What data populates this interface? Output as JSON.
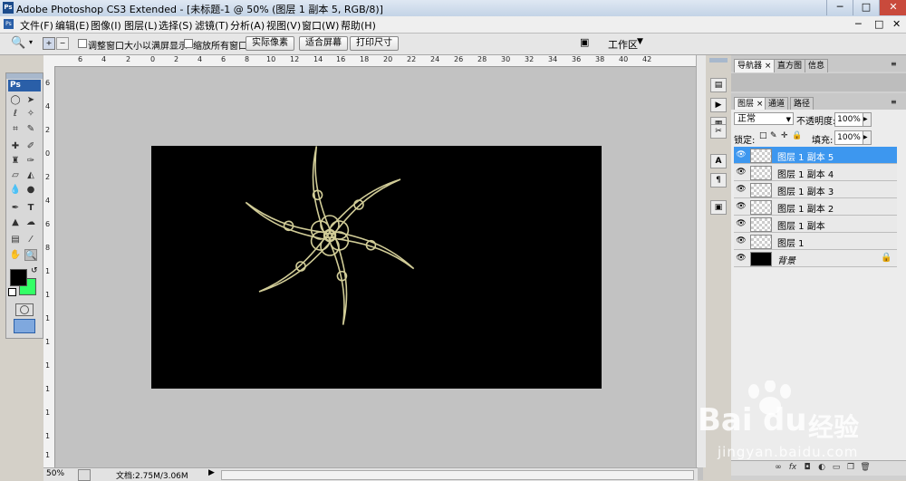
{
  "window": {
    "app_icon": "Ps",
    "title": "Adobe Photoshop CS3 Extended - [未标题-1 @ 50% (图层 1 副本 5, RGB/8)]",
    "controls": [
      "─",
      "□",
      "✕"
    ]
  },
  "menu": [
    "文件(F)",
    "编辑(E)",
    "图像(I)",
    "图层(L)",
    "选择(S)",
    "滤镜(T)",
    "分析(A)",
    "视图(V)",
    "窗口(W)",
    "帮助(H)"
  ],
  "menu_doc_controls": [
    "─",
    "□",
    "✕"
  ],
  "options": {
    "resize_windows": "调整窗口大小以满屏显示",
    "zoom_all": "缩放所有窗口",
    "actual_pixels": "实际像素",
    "fit_screen": "适合屏幕",
    "print_size": "打印尺寸",
    "workspace": "工作区"
  },
  "toolbox": {
    "logo": "Ps"
  },
  "rulers": {
    "h_ticks": [
      "6",
      "4",
      "2",
      "0",
      "2",
      "4",
      "6",
      "8",
      "10",
      "12",
      "14",
      "16",
      "18",
      "20",
      "22",
      "24",
      "26",
      "28",
      "30",
      "32",
      "34",
      "36",
      "38",
      "40",
      "42"
    ],
    "v_ticks": [
      "6",
      "4",
      "2",
      "0",
      "2",
      "4",
      "6",
      "8",
      "1",
      "1",
      "1",
      "1",
      "1",
      "1",
      "1",
      "1",
      "1",
      "1"
    ]
  },
  "status": {
    "zoom": "50%",
    "doc_info": "文档:2.75M/3.06M"
  },
  "panels": {
    "top_tabs": [
      "导航器",
      "直方图",
      "信息"
    ],
    "layer_tabs": [
      "图层",
      "通道",
      "路径"
    ],
    "blend_mode": "正常",
    "opacity_label": "不透明度:",
    "opacity_value": "100%",
    "lock_label": "锁定:",
    "fill_label": "填充:",
    "fill_value": "100%",
    "layers": [
      {
        "name": "图层 1 副本 5",
        "selected": true
      },
      {
        "name": "图层 1 副本 4",
        "selected": false
      },
      {
        "name": "图层 1 副本 3",
        "selected": false
      },
      {
        "name": "图层 1 副本 2",
        "selected": false
      },
      {
        "name": "图层 1 副本",
        "selected": false
      },
      {
        "name": "图层 1",
        "selected": false
      },
      {
        "name": "背景",
        "selected": false,
        "locked": true
      }
    ]
  },
  "watermark": {
    "brand": "Bai",
    "brand2": "du",
    "cn": "经验",
    "url": "jingyan.baidu.com"
  },
  "colors": {
    "foreground": "#000000",
    "background": "#33ff66",
    "selected_layer": "#3d97ef",
    "spiral": "#e8e3a8"
  }
}
